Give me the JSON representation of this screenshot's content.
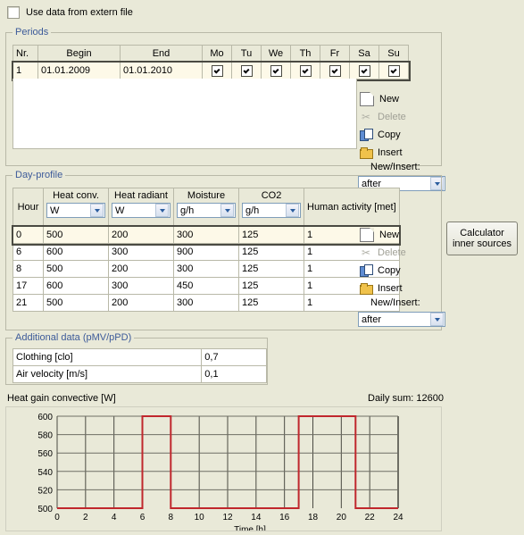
{
  "extern": {
    "label": "Use data from extern file",
    "checked": false
  },
  "periods": {
    "legend": "Periods",
    "columns": [
      "Nr.",
      "Begin",
      "End",
      "Mo",
      "Tu",
      "We",
      "Th",
      "Fr",
      "Sa",
      "Su"
    ],
    "rows": [
      {
        "nr": "1",
        "begin": "01.01.2009",
        "end": "01.01.2010",
        "days": [
          true,
          true,
          true,
          true,
          true,
          true,
          true
        ]
      }
    ],
    "actions": {
      "new": "New",
      "delete": "Delete",
      "copy": "Copy",
      "insert": "Insert",
      "new_insert_label": "New/Insert:",
      "mode_value": "after"
    }
  },
  "dayprofile": {
    "legend": "Day-profile",
    "columns": [
      {
        "title": "Hour",
        "unit": null
      },
      {
        "title": "Heat conv.",
        "unit": "W"
      },
      {
        "title": "Heat radiant",
        "unit": "W"
      },
      {
        "title": "Moisture",
        "unit": "g/h"
      },
      {
        "title": "CO2",
        "unit": "g/h"
      },
      {
        "title": "Human activity [met]",
        "unit": null
      }
    ],
    "rows": [
      {
        "hour": "0",
        "heat_conv": "500",
        "heat_rad": "200",
        "moisture": "300",
        "co2": "125",
        "human": "1",
        "selected": true
      },
      {
        "hour": "6",
        "heat_conv": "600",
        "heat_rad": "300",
        "moisture": "900",
        "co2": "125",
        "human": "1",
        "selected": false
      },
      {
        "hour": "8",
        "heat_conv": "500",
        "heat_rad": "200",
        "moisture": "300",
        "co2": "125",
        "human": "1",
        "selected": false
      },
      {
        "hour": "17",
        "heat_conv": "600",
        "heat_rad": "300",
        "moisture": "450",
        "co2": "125",
        "human": "1",
        "selected": false
      },
      {
        "hour": "21",
        "heat_conv": "500",
        "heat_rad": "200",
        "moisture": "300",
        "co2": "125",
        "human": "1",
        "selected": false
      }
    ],
    "actions": {
      "new": "New",
      "delete": "Delete",
      "copy": "Copy",
      "insert": "Insert",
      "new_insert_label": "New/Insert:",
      "mode_value": "after"
    }
  },
  "calculator_button": {
    "line1": "Calculator",
    "line2": "inner sources"
  },
  "additional": {
    "legend": "Additional data (pMV/pPD)",
    "rows": [
      {
        "label": "Clothing  [clo]",
        "value": "0,7"
      },
      {
        "label": "Air velocity  [m/s]",
        "value": "0,1"
      }
    ]
  },
  "chart_data": {
    "type": "line",
    "title": "Heat gain convective [W]",
    "daily_sum_label": "Daily sum: 12600",
    "daily_sum": 12600,
    "xlabel": "Time [h]",
    "ylabel": "",
    "xlim": [
      0,
      24
    ],
    "ylim": [
      500,
      600
    ],
    "xticks": [
      0,
      2,
      4,
      6,
      8,
      10,
      12,
      14,
      16,
      18,
      20,
      22,
      24
    ],
    "yticks": [
      500,
      520,
      540,
      560,
      580,
      600
    ],
    "grid": true,
    "legend_position": "none",
    "line_color": "#c0272d",
    "step": "post",
    "x": [
      0,
      6,
      8,
      17,
      21,
      24
    ],
    "values": [
      500,
      600,
      500,
      600,
      500,
      500
    ]
  }
}
